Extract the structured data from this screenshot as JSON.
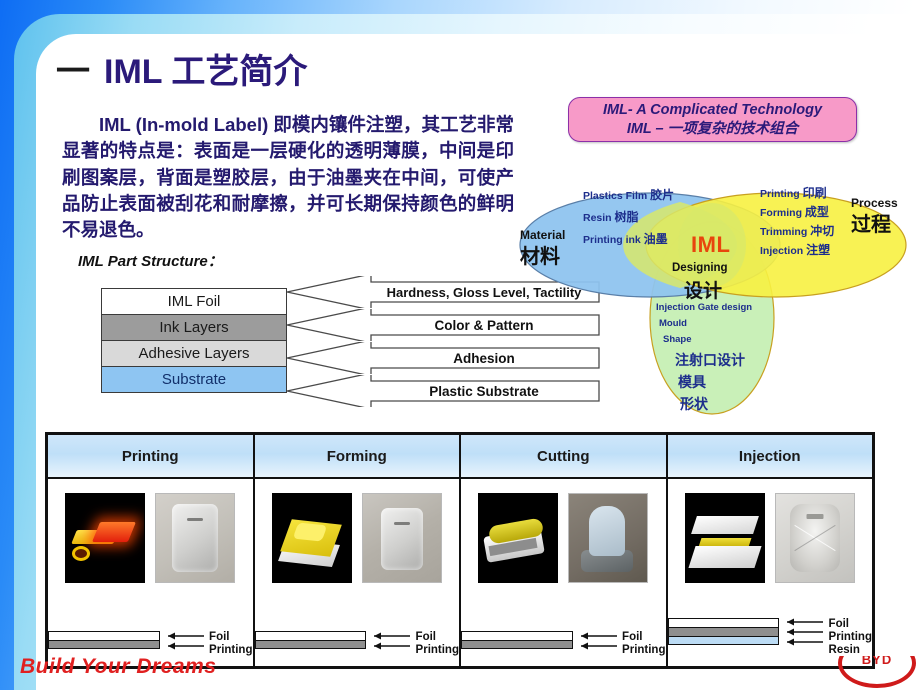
{
  "slide": {
    "title_number": "一",
    "title": "IML 工艺简介",
    "paragraph": "IML (In-mold Label) 即模内镶件注塑，其工艺非常显著的特点是：表面是一层硬化的透明薄膜，中间是印刷图案层，背面是塑胶层，由于油墨夹在中间，可使产品防止表面被刮花和耐摩擦，并可长期保持颜色的鲜明不易退色。",
    "structure_label": "IML Part Structure："
  },
  "layers": [
    {
      "name": "IML Foil",
      "callout": "Hardness, Gloss Level, Tactility"
    },
    {
      "name": "Ink Layers",
      "callout": "Color & Pattern"
    },
    {
      "name": "Adhesive Layers",
      "callout": "Adhesion"
    },
    {
      "name": "Substrate",
      "callout": "Plastic Substrate"
    }
  ],
  "banner": {
    "line1": "IML- A Complicated Technology",
    "line2": "IML – 一项复杂的技术组合"
  },
  "venn": {
    "material": {
      "title_en": "Material",
      "title_cn": "材料",
      "items": [
        {
          "en": "Plastics Film",
          "cn": "胶片"
        },
        {
          "en": "Resin",
          "cn": "树脂"
        },
        {
          "en": "Printing ink",
          "cn": "油墨"
        }
      ]
    },
    "process": {
      "title_en": "Process",
      "title_cn": "过程",
      "items": [
        {
          "en": "Printing",
          "cn": "印刷"
        },
        {
          "en": "Forming",
          "cn": "成型"
        },
        {
          "en": "Trimming",
          "cn": "冲切"
        },
        {
          "en": "Injection",
          "cn": "注塑"
        }
      ]
    },
    "designing": {
      "title_en": "Designing",
      "title_cn": "设计",
      "items_en": [
        "Injection Gate design",
        "Mould",
        "Shape"
      ],
      "items_cn": [
        "注射口设计",
        "模具",
        "形状"
      ]
    },
    "center_label": "IML",
    "colors": {
      "material": "#8ec3ef",
      "process": "#f7f141",
      "designing": "#c9f0b8",
      "center": "#d8e86a"
    }
  },
  "process_table": {
    "columns": [
      {
        "header": "Printing",
        "strip_labels": [
          "Foil",
          "Printing"
        ],
        "strip_bars": [
          "foil",
          "printing"
        ]
      },
      {
        "header": "Forming",
        "strip_labels": [
          "Foil",
          "Printing"
        ],
        "strip_bars": [
          "foil",
          "printing"
        ]
      },
      {
        "header": "Cutting",
        "strip_labels": [
          "Foil",
          "Printing"
        ],
        "strip_bars": [
          "foil",
          "printing"
        ]
      },
      {
        "header": "Injection",
        "strip_labels": [
          "Foil",
          "Printing",
          "Resin"
        ],
        "strip_bars": [
          "foil",
          "printing",
          "resin"
        ]
      }
    ]
  },
  "footer": {
    "tagline": "Build Your Dreams",
    "logo_text": "BYD",
    "tagline_color": "#e02020",
    "logo_color": "#cf1a1a"
  }
}
